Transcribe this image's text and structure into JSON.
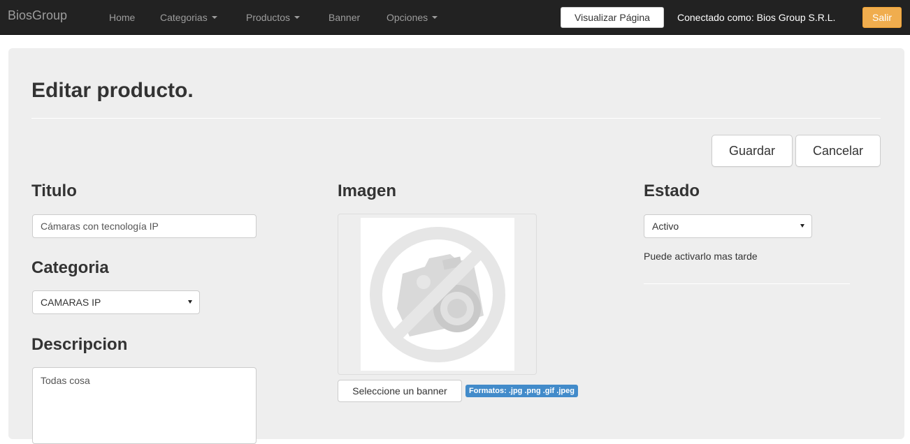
{
  "navbar": {
    "brand": "BiosGroup",
    "items": [
      {
        "label": "Home",
        "dropdown": false
      },
      {
        "label": "Categorias",
        "dropdown": true
      },
      {
        "label": "Productos",
        "dropdown": true
      },
      {
        "label": "Banner",
        "dropdown": false
      },
      {
        "label": "Opciones",
        "dropdown": true
      }
    ],
    "view_page_label": "Visualizar Página",
    "connected_as": "Conectado como: Bios Group S.R.L.",
    "exit_label": "Salir"
  },
  "page": {
    "title": "Editar producto.",
    "save_label": "Guardar",
    "cancel_label": "Cancelar"
  },
  "form": {
    "titulo": {
      "heading": "Titulo",
      "value": "Cámaras con tecnología IP"
    },
    "categoria": {
      "heading": "Categoria",
      "selected": "CAMARAS IP"
    },
    "descripcion": {
      "heading": "Descripcion",
      "value": "Todas cosa"
    },
    "imagen": {
      "heading": "Imagen",
      "file_button_label": "Seleccione un banner",
      "formats_label": "Formatos: .jpg .png .gif .jpeg",
      "placeholder_icon": "no-camera-icon"
    },
    "estado": {
      "heading": "Estado",
      "selected": "Activo",
      "help": "Puede activarlo mas tarde"
    }
  },
  "colors": {
    "navbar_bg": "#222222",
    "panel_bg": "#eeeeee",
    "exit_button": "#f0ad4e",
    "info_label": "#428bca"
  }
}
